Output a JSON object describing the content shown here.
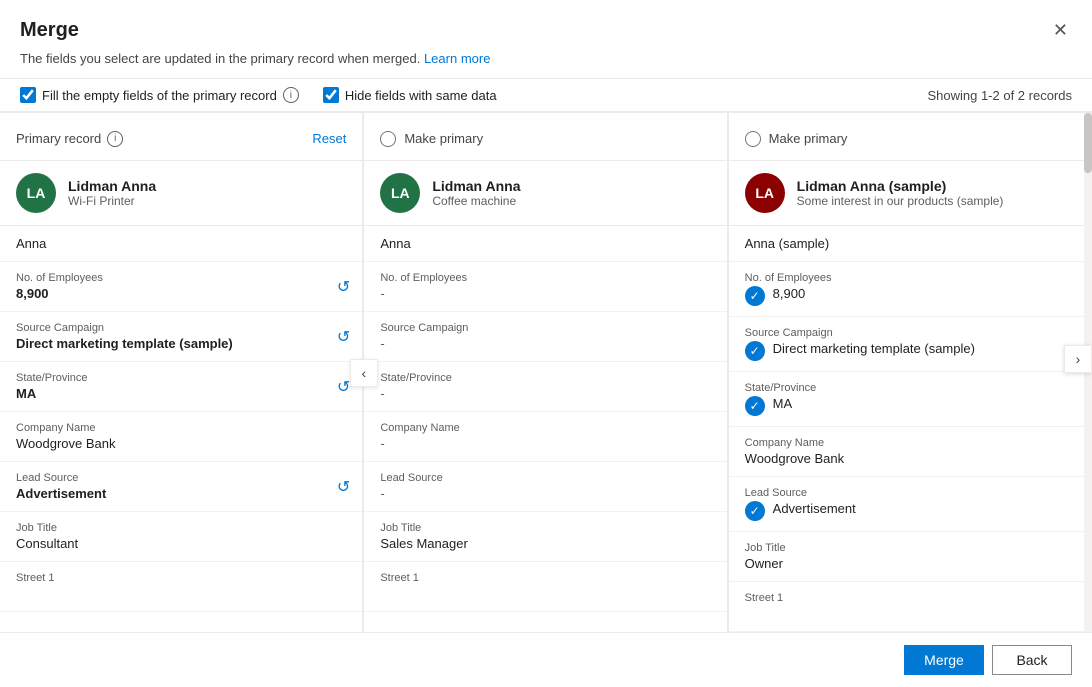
{
  "modal": {
    "title": "Merge",
    "subtitle": "The fields you select are updated in the primary record when merged.",
    "learn_more": "Learn more",
    "close_label": "×"
  },
  "options": {
    "fill_empty": "Fill the empty fields of the primary record",
    "hide_same": "Hide fields with same data",
    "records_count": "Showing 1-2 of 2 records"
  },
  "columns": [
    {
      "type": "primary",
      "header_label": "Primary record",
      "reset_label": "Reset",
      "avatar_text": "LA",
      "avatar_color": "#217346",
      "record_name": "Lidman Anna",
      "record_sub": "Wi-Fi Printer",
      "simple_name": "Anna",
      "fields": [
        {
          "label": "No. of Employees",
          "value": "8,900",
          "bold": true,
          "has_revert": true
        },
        {
          "label": "Source Campaign",
          "value": "Direct marketing template (sample)",
          "bold": true,
          "has_revert": true
        },
        {
          "label": "State/Province",
          "value": "MA",
          "bold": true,
          "has_revert": true
        },
        {
          "label": "Company Name",
          "value": "Woodgrove Bank",
          "bold": false,
          "has_revert": false
        },
        {
          "label": "Lead Source",
          "value": "Advertisement",
          "bold": true,
          "has_revert": true
        },
        {
          "label": "Job Title",
          "value": "Consultant",
          "bold": false,
          "has_revert": false
        },
        {
          "label": "Street 1",
          "value": "",
          "bold": false,
          "has_revert": false
        }
      ]
    },
    {
      "type": "secondary",
      "header_label": "Make primary",
      "avatar_text": "LA",
      "avatar_color": "#217346",
      "record_name": "Lidman Anna",
      "record_sub": "Coffee machine",
      "simple_name": "Anna",
      "fields": [
        {
          "label": "No. of Employees",
          "value": "-",
          "bold": false
        },
        {
          "label": "Source Campaign",
          "value": "-",
          "bold": false
        },
        {
          "label": "State/Province",
          "value": "-",
          "bold": false
        },
        {
          "label": "Company Name",
          "value": "-",
          "bold": false
        },
        {
          "label": "Lead Source",
          "value": "-",
          "bold": false
        },
        {
          "label": "Job Title",
          "value": "Sales Manager",
          "bold": false
        },
        {
          "label": "Street 1",
          "value": "",
          "bold": false
        }
      ]
    },
    {
      "type": "secondary",
      "header_label": "Make primary",
      "avatar_text": "LA",
      "avatar_color": "#8B0000",
      "record_name": "Lidman Anna (sample)",
      "record_sub": "Some interest in our products (sample)",
      "simple_name": "Anna (sample)",
      "fields": [
        {
          "label": "No. of Employees",
          "value": "8,900",
          "bold": false,
          "checked": true
        },
        {
          "label": "Source Campaign",
          "value": "Direct marketing template (sample)",
          "bold": false,
          "checked": true
        },
        {
          "label": "State/Province",
          "value": "MA",
          "bold": false,
          "checked": true
        },
        {
          "label": "Company Name",
          "value": "Woodgrove Bank",
          "bold": false
        },
        {
          "label": "Lead Source",
          "value": "Advertisement",
          "bold": false,
          "checked": true
        },
        {
          "label": "Job Title",
          "value": "Owner",
          "bold": false
        },
        {
          "label": "Street 1",
          "value": "",
          "bold": false
        }
      ]
    }
  ],
  "buttons": {
    "merge": "Merge",
    "back": "Back"
  }
}
